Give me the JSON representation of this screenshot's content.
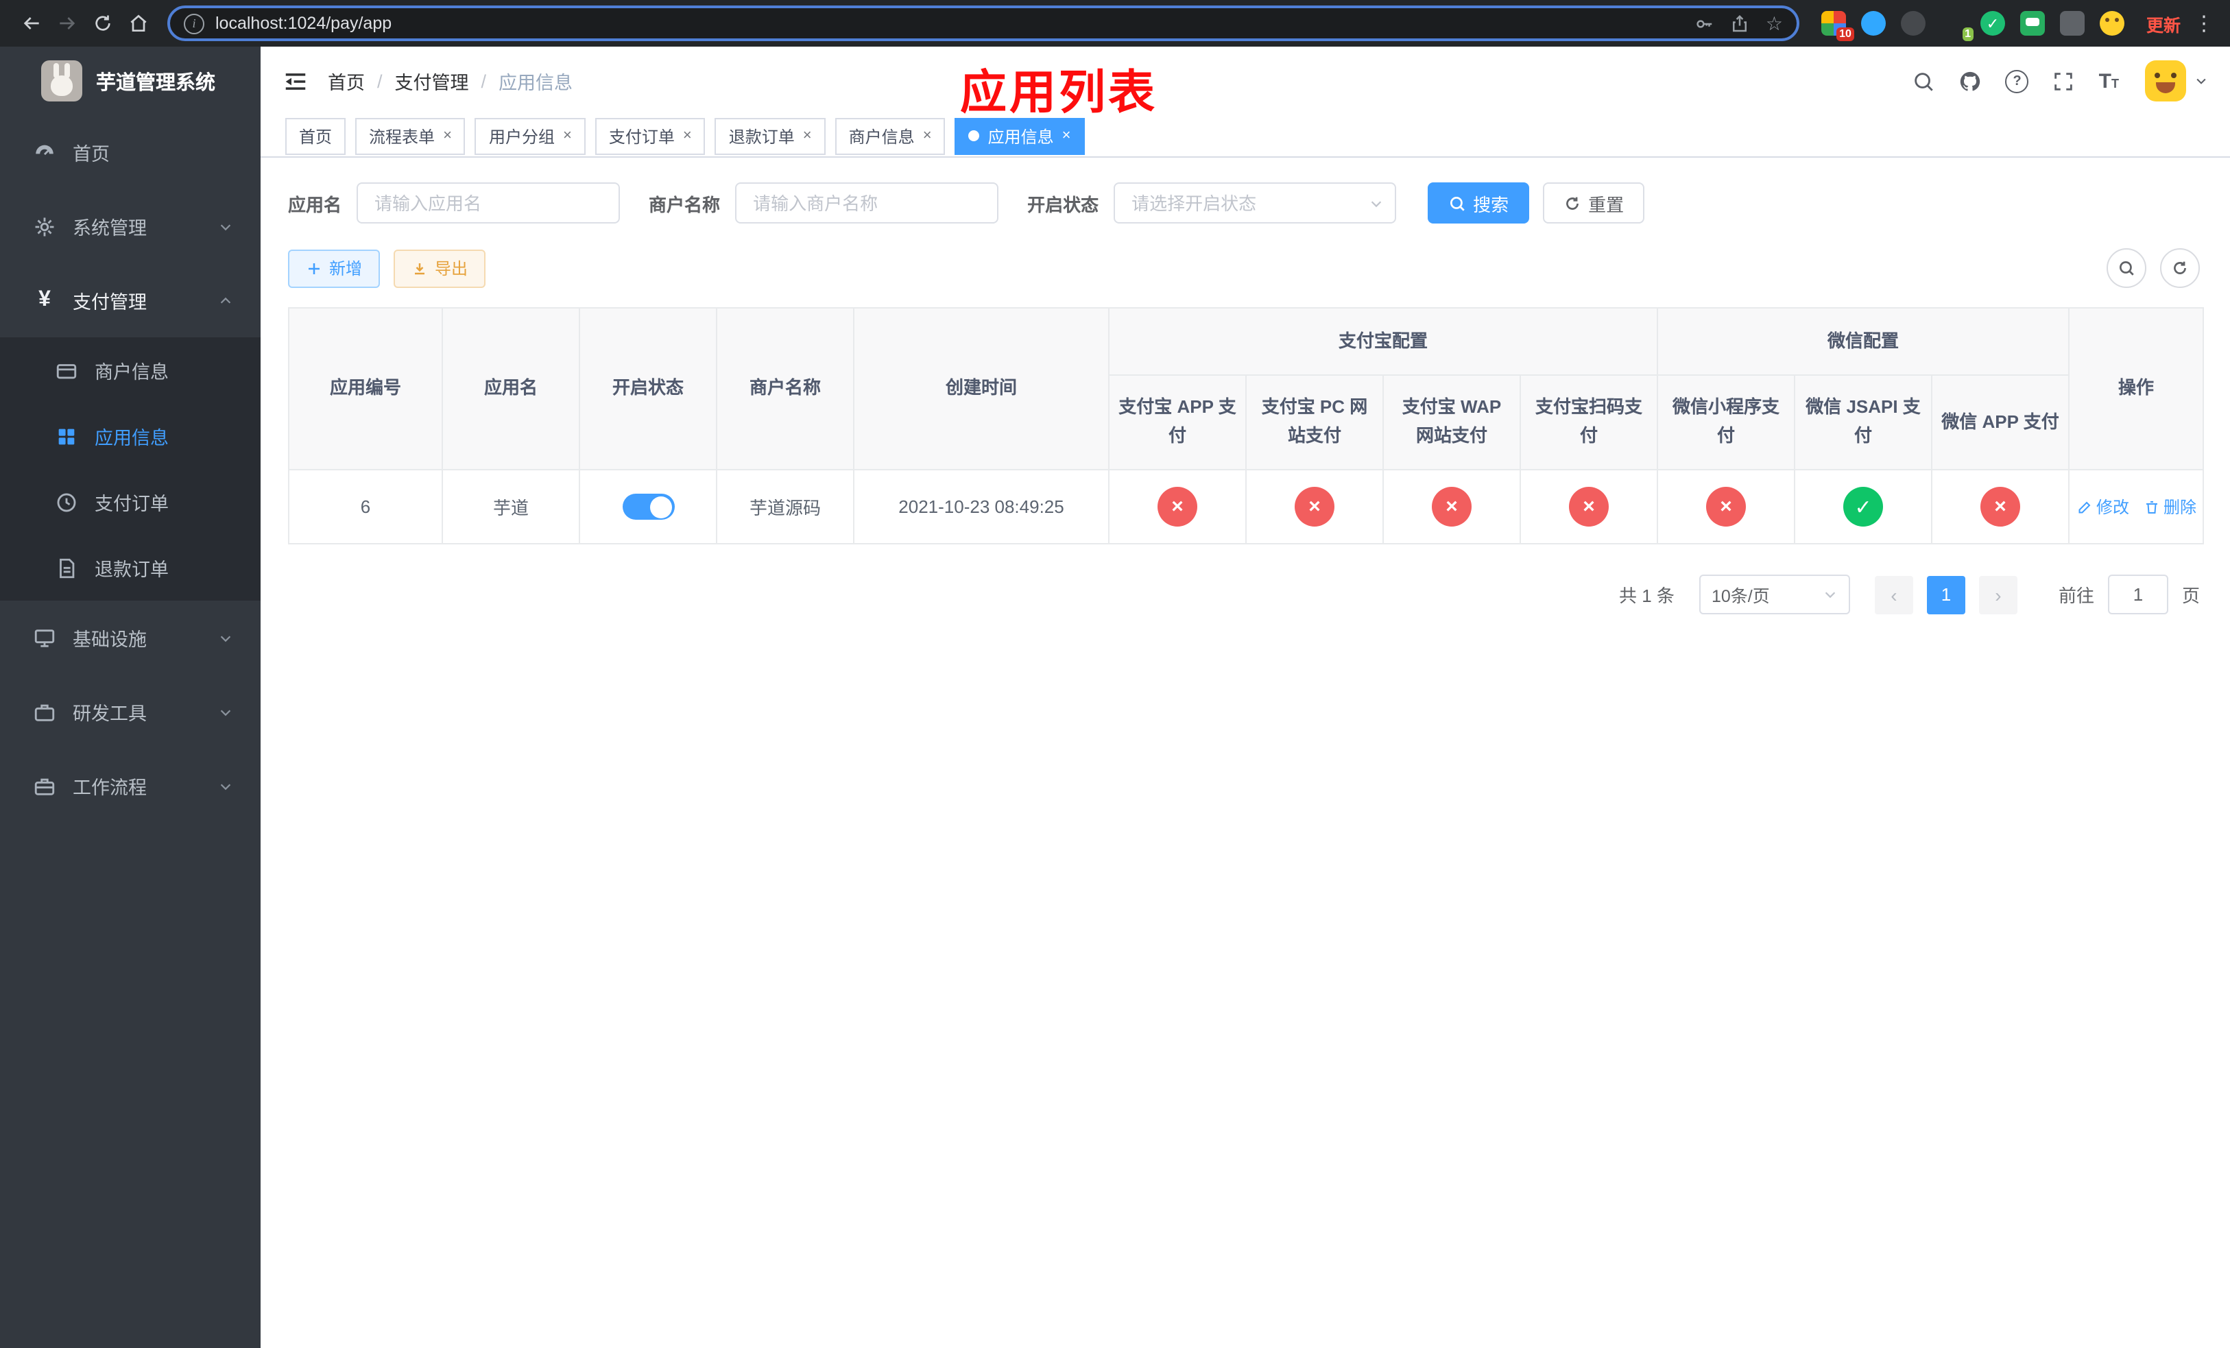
{
  "browser": {
    "url": "localhost:1024/pay/app",
    "update_label": "更新",
    "ext_badge_10": "10",
    "ext_badge_1": "1"
  },
  "sidebar": {
    "title": "芋道管理系统",
    "items": [
      {
        "label": "首页"
      },
      {
        "label": "系统管理"
      },
      {
        "label": "支付管理"
      },
      {
        "label": "基础设施"
      },
      {
        "label": "研发工具"
      },
      {
        "label": "工作流程"
      }
    ],
    "submenu": [
      {
        "label": "商户信息"
      },
      {
        "label": "应用信息"
      },
      {
        "label": "支付订单"
      },
      {
        "label": "退款订单"
      }
    ]
  },
  "breadcrumb": {
    "separator": "/",
    "items": [
      "首页",
      "支付管理",
      "应用信息"
    ]
  },
  "annotation": "应用列表",
  "tabs": [
    {
      "label": "首页"
    },
    {
      "label": "流程表单"
    },
    {
      "label": "用户分组"
    },
    {
      "label": "支付订单"
    },
    {
      "label": "退款订单"
    },
    {
      "label": "商户信息"
    },
    {
      "label": "应用信息"
    }
  ],
  "filters": {
    "app_name_label": "应用名",
    "app_name_placeholder": "请输入应用名",
    "merchant_label": "商户名称",
    "merchant_placeholder": "请输入商户名称",
    "status_label": "开启状态",
    "status_placeholder": "请选择开启状态",
    "search_label": "搜索",
    "reset_label": "重置"
  },
  "toolbar": {
    "add_label": "新增",
    "export_label": "导出"
  },
  "table": {
    "group_headers": {
      "alipay": "支付宝配置",
      "wechat": "微信配置"
    },
    "columns": [
      "应用编号",
      "应用名",
      "开启状态",
      "商户名称",
      "创建时间",
      "支付宝 APP 支付",
      "支付宝 PC 网站支付",
      "支付宝 WAP 网站支付",
      "支付宝扫码支付",
      "微信小程序支付",
      "微信 JSAPI 支付",
      "微信 APP 支付",
      "操作"
    ],
    "row": {
      "id": "6",
      "name": "芋道",
      "enabled": true,
      "merchant": "芋道源码",
      "created": "2021-10-23 08:49:25",
      "alipay_app": false,
      "alipay_pc": false,
      "alipay_wap": false,
      "alipay_qr": false,
      "wechat_lite": false,
      "wechat_jsapi": true,
      "wechat_app": false,
      "edit_label": "修改",
      "delete_label": "删除"
    }
  },
  "pagination": {
    "total": "共 1 条",
    "page_size": "10条/页",
    "current_page": "1",
    "goto_label": "前往",
    "goto_value": "1",
    "page_unit": "页"
  },
  "colors": {
    "primary": "#409eff",
    "danger": "#f25e5e",
    "success": "#0fc568",
    "warning": "#e6a23c"
  }
}
